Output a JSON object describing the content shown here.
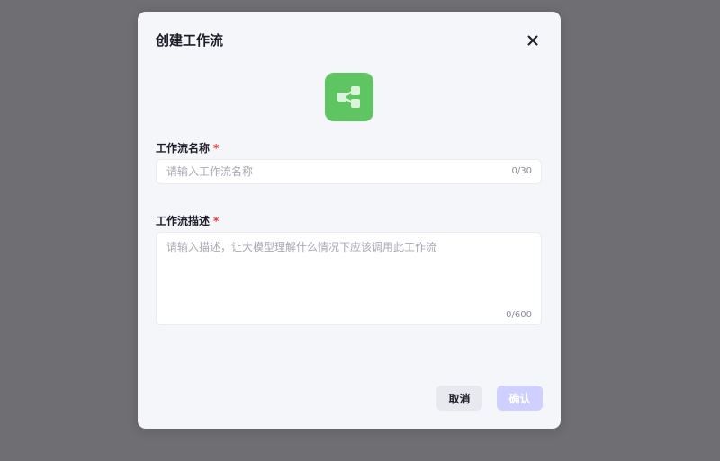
{
  "colors": {
    "overlay": "#6f6e73",
    "modal_bg": "#f5f6fa",
    "icon_bg": "#5fc562",
    "required": "#e53935",
    "confirm_bg": "#cfd0ff",
    "cancel_bg": "#e7e9ef"
  },
  "dialog": {
    "title": "创建工作流",
    "close_icon": "close-icon",
    "workflow_icon": "workflow-share-icon"
  },
  "name_field": {
    "label": "工作流名称",
    "required_mark": "*",
    "placeholder": "请输入工作流名称",
    "value": "",
    "counter": "0/30"
  },
  "description_field": {
    "label": "工作流描述",
    "required_mark": "*",
    "placeholder": "请输入描述，让大模型理解什么情况下应该调用此工作流",
    "value": "",
    "counter": "0/600"
  },
  "footer": {
    "cancel_label": "取消",
    "confirm_label": "确认"
  }
}
